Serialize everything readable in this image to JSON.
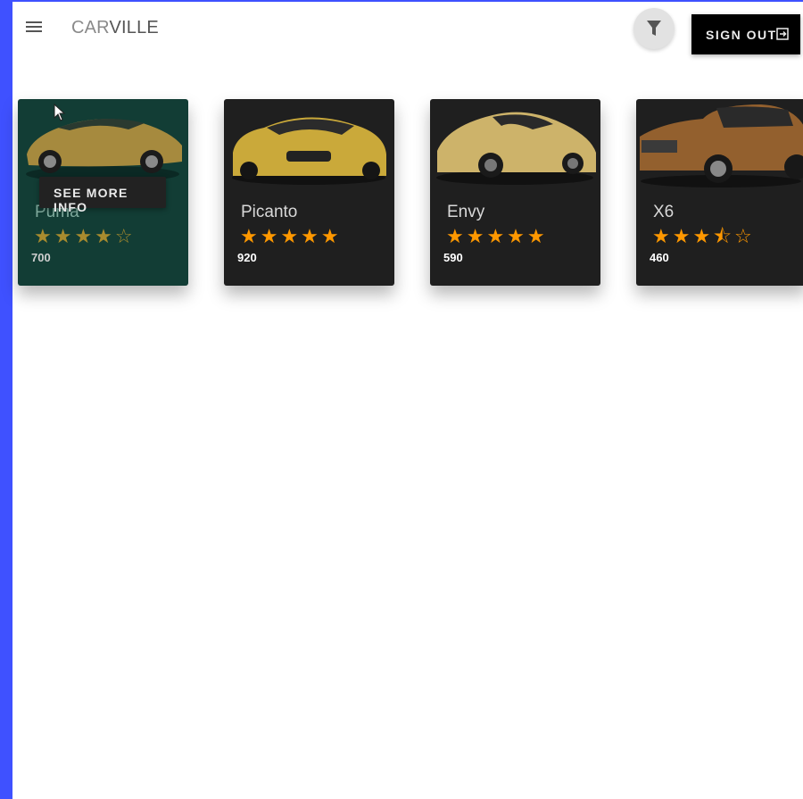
{
  "app": {
    "brand_light": "CAR",
    "brand_strong": "VILLE"
  },
  "header": {
    "menu_icon": "menu-icon",
    "filter_icon": "filter-icon",
    "sign_out_label": "SIGN OUT",
    "sign_out_icon": "exit-icon"
  },
  "tooltip": {
    "label": "SEE MORE INFO"
  },
  "cars": [
    {
      "name": "Puma",
      "price": "700",
      "rating": 4,
      "stars": "★★★★☆",
      "image_color": "#b69a45",
      "state": "hover"
    },
    {
      "name": "Picanto",
      "price": "920",
      "rating": 5,
      "stars": "★★★★★",
      "image_color": "#d6b844"
    },
    {
      "name": "Envy",
      "price": "590",
      "rating": 5,
      "stars": "★★★★★",
      "image_color": "#d1ba6c"
    },
    {
      "name": "X6",
      "price": "460",
      "rating": 3.5,
      "stars": "★★★⯪☆",
      "image_color": "#9a6530"
    }
  ],
  "colors": {
    "accent_strip": "#3f51ff",
    "card_bg": "#1f1f1f",
    "card_hover_bg": "#123d35",
    "star": "#ff9800"
  }
}
